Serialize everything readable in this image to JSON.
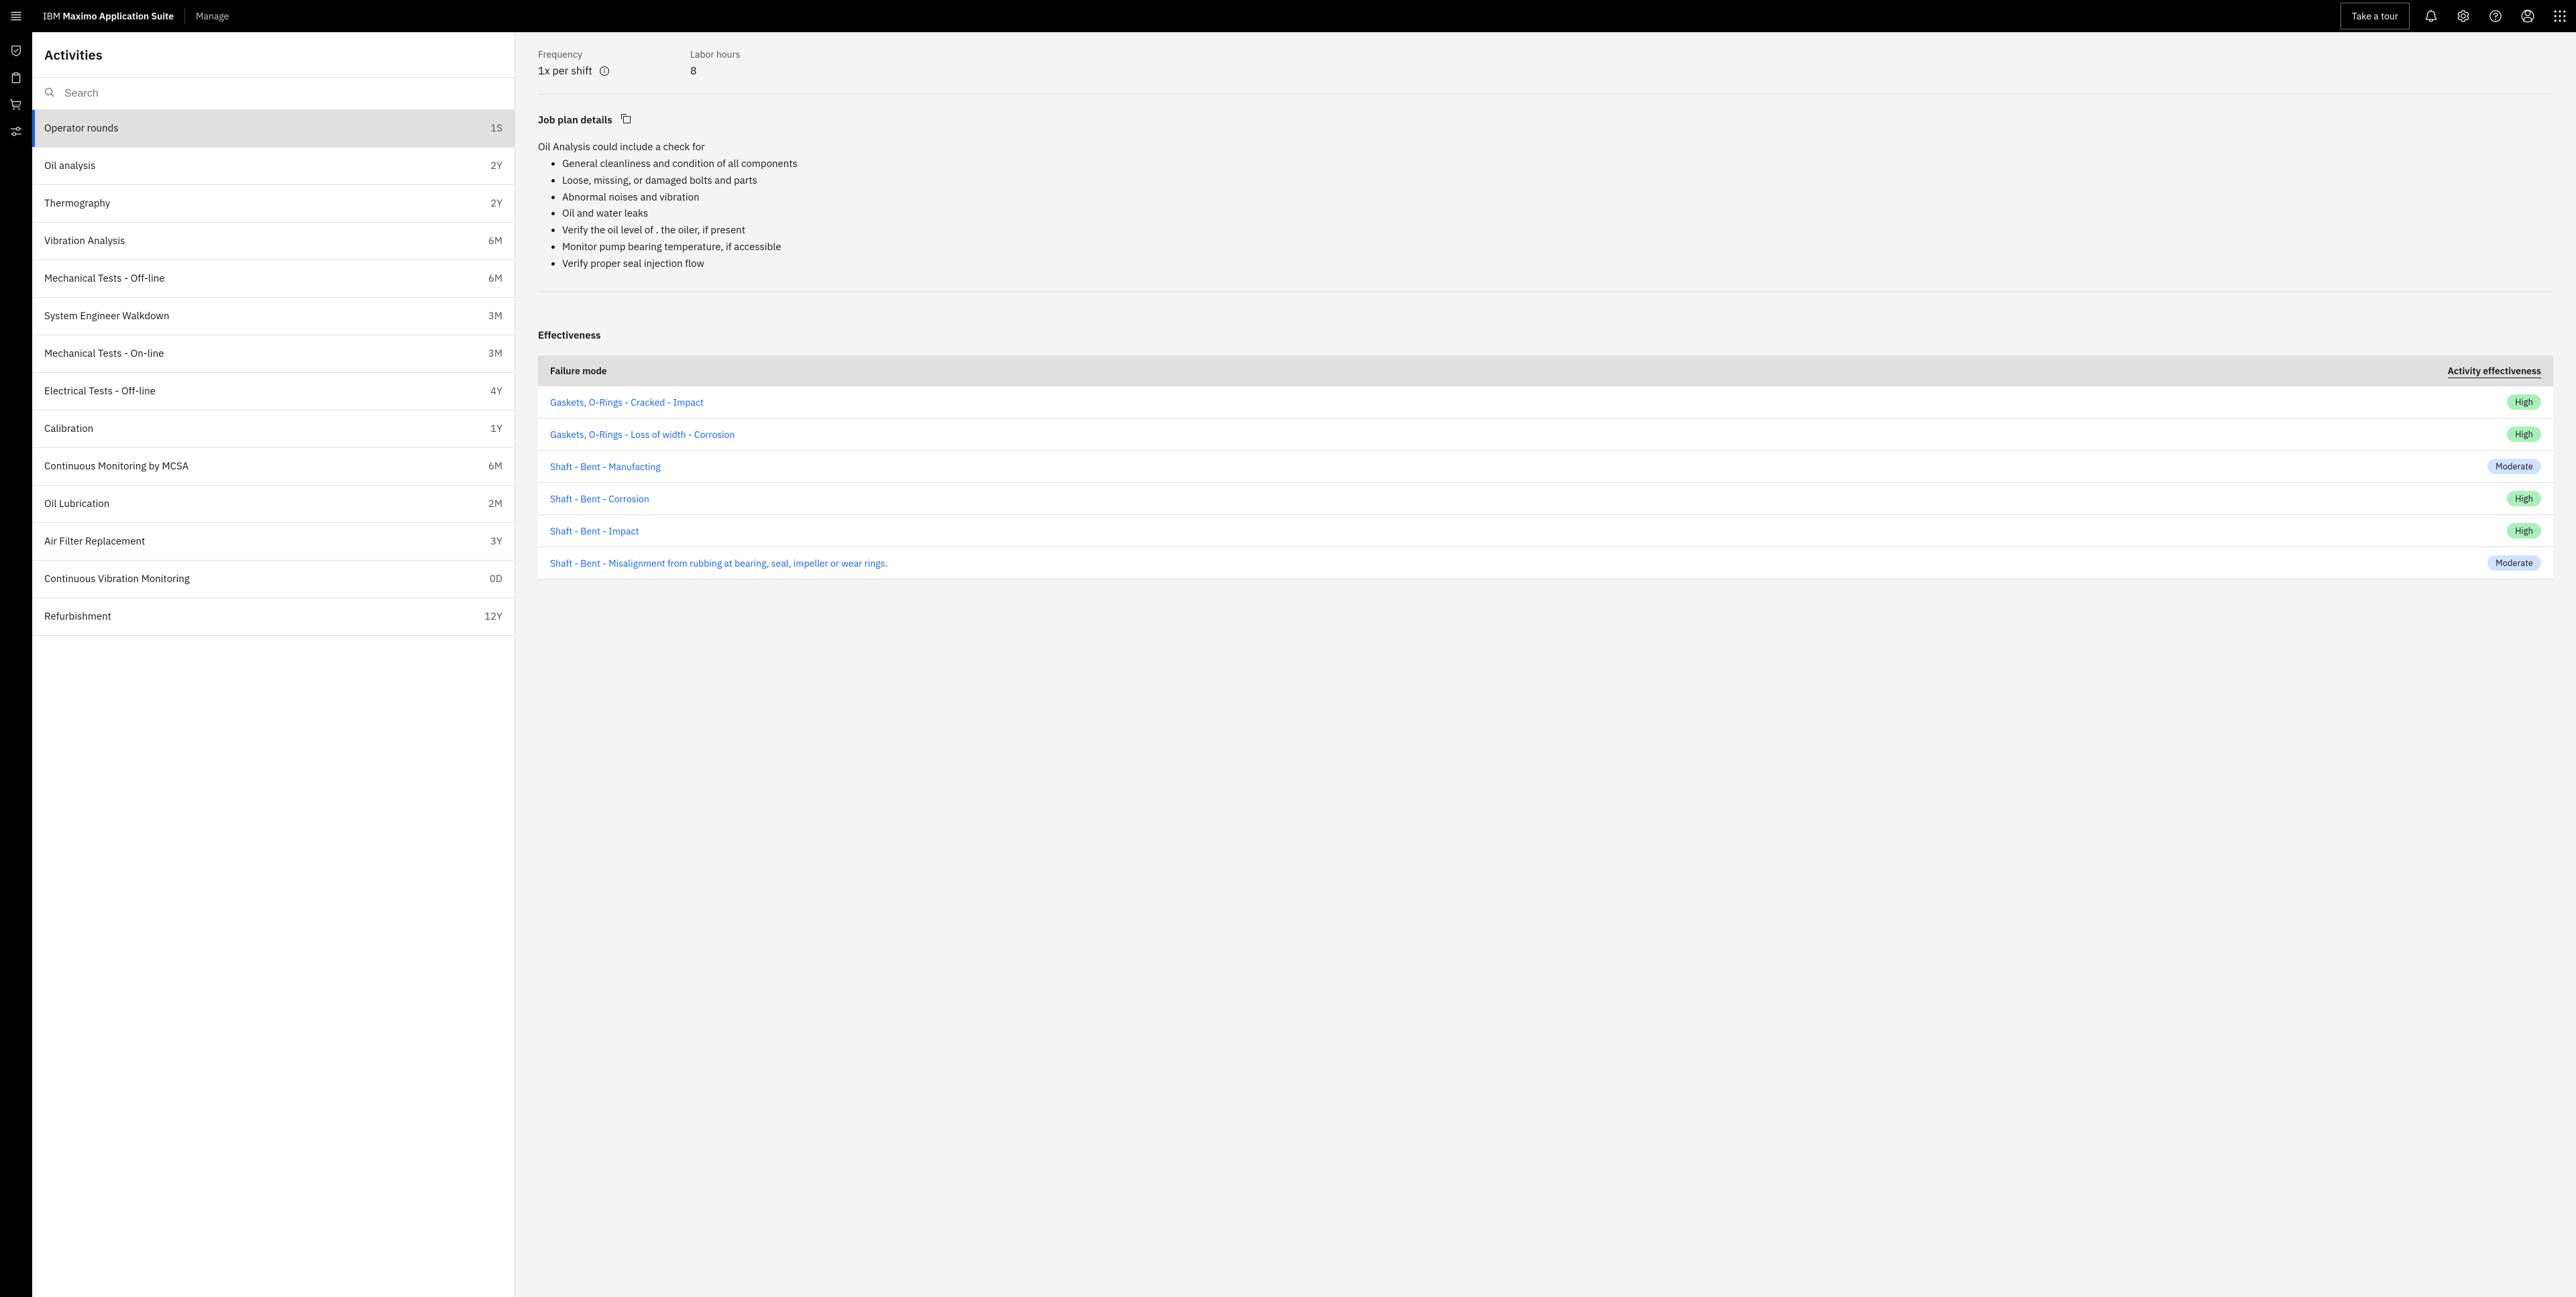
{
  "header": {
    "brand_prefix": "IBM ",
    "brand_main": "Maximo Application Suite",
    "sublabel": "Manage",
    "tour_label": "Take a tour"
  },
  "panel": {
    "title": "Activities",
    "search_placeholder": "Search"
  },
  "activities": [
    {
      "name": "Operator rounds",
      "freq": "1S",
      "selected": true
    },
    {
      "name": "Oil analysis",
      "freq": "2Y"
    },
    {
      "name": "Thermography",
      "freq": "2Y"
    },
    {
      "name": "Vibration Analysis",
      "freq": "6M"
    },
    {
      "name": "Mechanical Tests - Off-line",
      "freq": "6M"
    },
    {
      "name": "System Engineer Walkdown",
      "freq": "3M"
    },
    {
      "name": "Mechanical Tests - On-line",
      "freq": "3M"
    },
    {
      "name": "Electrical Tests - Off-line",
      "freq": "4Y"
    },
    {
      "name": "Calibration",
      "freq": "1Y"
    },
    {
      "name": "Continuous Monitoring by MCSA",
      "freq": "6M"
    },
    {
      "name": "Oil Lubrication",
      "freq": "2M"
    },
    {
      "name": "Air Filter Replacement",
      "freq": "3Y"
    },
    {
      "name": "Continuous Vibration Monitoring",
      "freq": "0D"
    },
    {
      "name": "Refurbishment",
      "freq": "12Y"
    }
  ],
  "details": {
    "frequency_label": "Frequency",
    "frequency_value": "1x per shift",
    "labor_label": "Labor hours",
    "labor_value": "8",
    "jobplan_title": "Job plan details",
    "jobplan_intro": "Oil Analysis could include a check for",
    "jobplan_items": [
      "General cleanliness and condition of all components",
      "Loose, missing, or damaged bolts and parts",
      "Abnormal noises and vibration",
      "Oil and water leaks",
      "Verify the oil level of . the oiler, if present",
      "Monitor pump bearing temperature, if accessible",
      "Verify proper seal injection flow"
    ],
    "effectiveness_title": "Effectiveness",
    "table_headers": {
      "mode": "Failure mode",
      "eff": "Activity effectiveness"
    },
    "rows": [
      {
        "mode": "Gaskets, O-Rings - Cracked - Impact",
        "eff": "High"
      },
      {
        "mode": "Gaskets, O-Rings - Loss of width - Corrosion",
        "eff": "High"
      },
      {
        "mode": "Shaft - Bent - Manufacting",
        "eff": "Moderate"
      },
      {
        "mode": "Shaft - Bent - Corrosion",
        "eff": "High"
      },
      {
        "mode": "Shaft - Bent - Impact",
        "eff": "High"
      },
      {
        "mode": "Shaft - Bent - Misalignment from rubbing at bearing, seal, impeller or wear rings.",
        "eff": "Moderate"
      }
    ]
  }
}
